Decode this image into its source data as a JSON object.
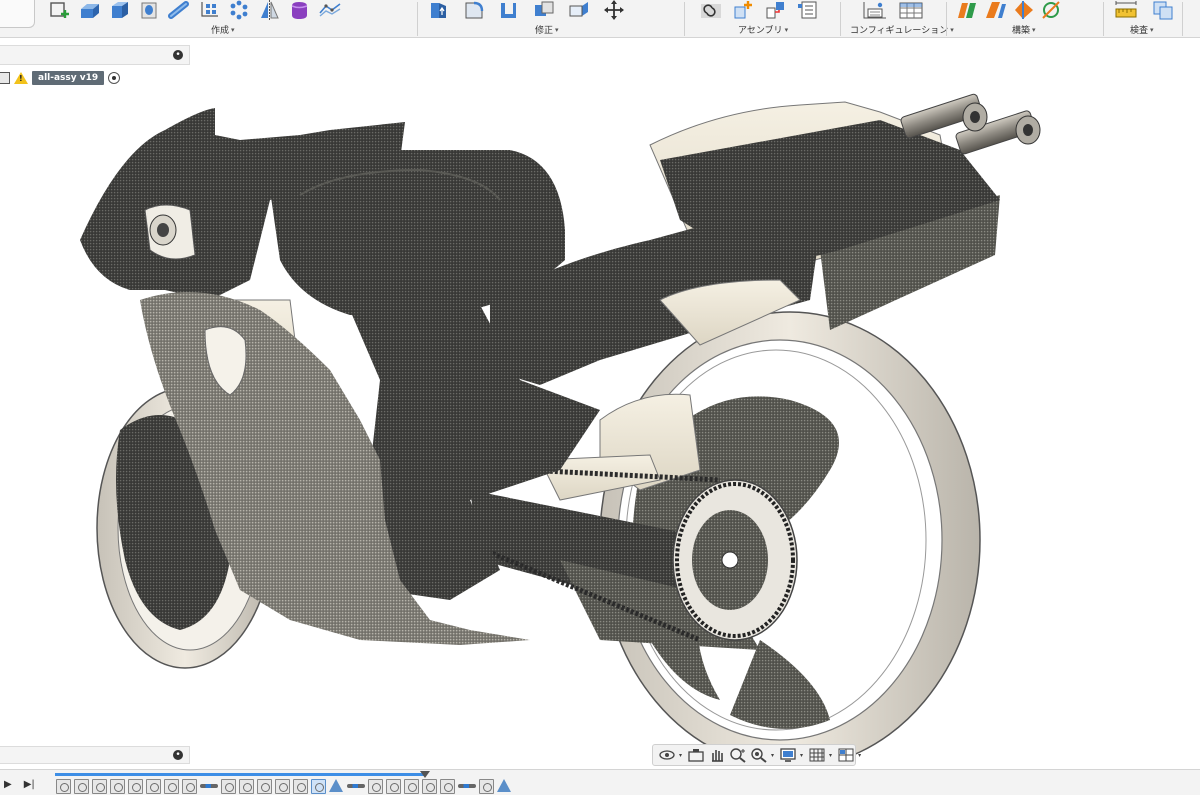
{
  "toolbar": {
    "groups": [
      {
        "label": "作成",
        "icons": [
          "new-sketch-icon",
          "extrude-icon",
          "box-icon",
          "cylinder-hole-icon",
          "pipe-icon",
          "rectangular-pattern-icon",
          "circular-pattern-icon",
          "mirror-icon",
          "form-icon",
          "insert-mesh-icon"
        ]
      },
      {
        "label": "修正",
        "icons": [
          "press-pull-icon",
          "fillet-icon",
          "shell-icon",
          "combine-icon",
          "replace-face-icon",
          "move-icon"
        ]
      },
      {
        "label": "アセンブリ",
        "icons": [
          "joint-icon",
          "new-component-icon",
          "as-built-joint-icon",
          "rigid-group-icon"
        ]
      },
      {
        "label": "コンフィギュレーション",
        "icons": [
          "configure-icon",
          "configuration-table-icon"
        ]
      },
      {
        "label": "構築",
        "icons": [
          "offset-plane-icon",
          "plane-at-angle-icon",
          "midplane-icon",
          "axis-icon"
        ]
      },
      {
        "label": "検査",
        "icons": [
          "measure-icon",
          "interference-icon"
        ]
      }
    ],
    "caret": "▾"
  },
  "browser": {
    "collapse_glyph": "•",
    "document_tag": "all-assy v19",
    "warning_glyph": "!"
  },
  "viewport": {
    "model": "motorcycle-assembly-with-mesh-scan"
  },
  "comments": {
    "collapse_glyph": "•"
  },
  "navbar": {
    "tools": [
      "orbit-icon",
      "look-at-icon",
      "pan-icon",
      "zoom-icon",
      "fit-icon",
      "display-settings-icon",
      "grid-settings-icon",
      "viewports-icon"
    ]
  },
  "timeline": {
    "controls": [
      "▶",
      "▶|"
    ],
    "progress": 1.0,
    "items": [
      "op",
      "op",
      "op",
      "op",
      "op",
      "op",
      "op",
      "op",
      "joint",
      "op",
      "op",
      "op",
      "op",
      "op",
      "blue",
      "tri",
      "joint",
      "op",
      "op",
      "op",
      "op",
      "op",
      "joint",
      "op",
      "tri"
    ]
  }
}
